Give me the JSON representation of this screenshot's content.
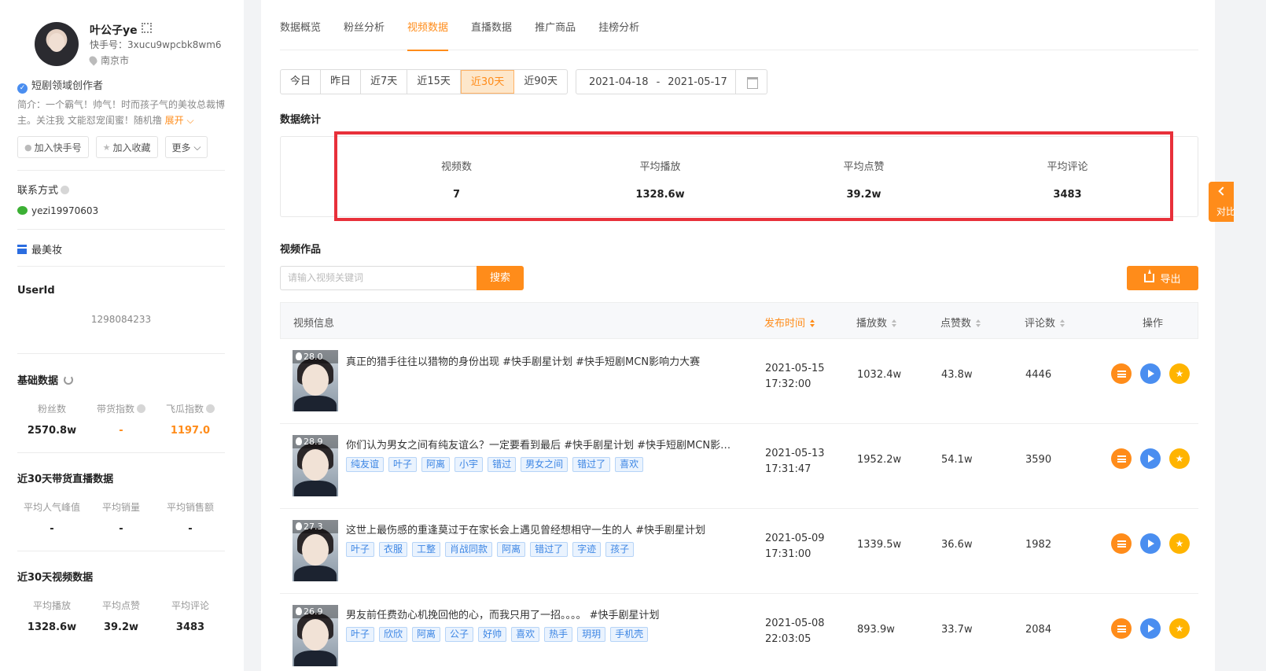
{
  "profile": {
    "name": "叶公子ye",
    "ks_id": "快手号：3xucu9wpcbk8wm6",
    "location": "南京市",
    "creator_label": "短剧领域创作者",
    "intro": "简介：一个霸气！帅气！时而孩子气的美妆总裁博主。关注我 文能怼宠闺蜜！随机撸",
    "expand": "展开",
    "btn_add_ks": "加入快手号",
    "btn_add_fav": "加入收藏",
    "btn_more": "更多"
  },
  "contact": {
    "title": "联系方式",
    "wechat": "yezi19970603"
  },
  "mcn": {
    "label": "最美妆"
  },
  "userid": {
    "title": "UserId",
    "value": "1298084233"
  },
  "basic": {
    "title": "基础数据",
    "items": [
      {
        "label": "粉丝数",
        "value": "2570.8w"
      },
      {
        "label": "带货指数",
        "value": "-"
      },
      {
        "label": "飞瓜指数",
        "value": "1197.0"
      }
    ]
  },
  "live30": {
    "title": "近30天带货直播数据",
    "items": [
      {
        "label": "平均人气峰值",
        "value": "-"
      },
      {
        "label": "平均销量",
        "value": "-"
      },
      {
        "label": "平均销售额",
        "value": "-"
      }
    ]
  },
  "video30": {
    "title": "近30天视频数据",
    "items": [
      {
        "label": "平均播放",
        "value": "1328.6w"
      },
      {
        "label": "平均点赞",
        "value": "39.2w"
      },
      {
        "label": "平均评论",
        "value": "3483"
      }
    ]
  },
  "tabs": [
    "数据概览",
    "粉丝分析",
    "视频数据",
    "直播数据",
    "推广商品",
    "挂榜分析"
  ],
  "ranges": [
    "今日",
    "昨日",
    "近7天",
    "近15天",
    "近30天",
    "近90天"
  ],
  "date_range": {
    "start": "2021-04-18",
    "sep": "-",
    "end": "2021-05-17"
  },
  "stats": {
    "title": "数据统计",
    "items": [
      {
        "label": "视频数",
        "value": "7"
      },
      {
        "label": "平均播放",
        "value": "1328.6w"
      },
      {
        "label": "平均点赞",
        "value": "39.2w"
      },
      {
        "label": "平均评论",
        "value": "3483"
      }
    ]
  },
  "works": {
    "title": "视频作品",
    "search_placeholder": "请输入视频关键词",
    "search_btn": "搜索",
    "export_btn": "导出",
    "columns": [
      "视频信息",
      "发布时间",
      "播放数",
      "点赞数",
      "评论数",
      "操作"
    ],
    "rows": [
      {
        "score": "28.0",
        "title": "真正的猎手往往以猎物的身份出现 #快手剧星计划 #快手短剧MCN影响力大赛",
        "tags": [],
        "date": "2021-05-15",
        "time": "17:32:00",
        "plays": "1032.4w",
        "likes": "43.8w",
        "comments": "4446"
      },
      {
        "score": "28.9",
        "title": "你们认为男女之间有纯友谊么？一定要看到最后 #快手剧星计划 #快手短剧MCN影…",
        "tags": [
          "纯友谊",
          "叶子",
          "阿离",
          "小宇",
          "错过",
          "男女之间",
          "错过了",
          "喜欢"
        ],
        "date": "2021-05-13",
        "time": "17:31:47",
        "plays": "1952.2w",
        "likes": "54.1w",
        "comments": "3590"
      },
      {
        "score": "27.3",
        "title": "这世上最伤感的重逢莫过于在家长会上遇见曾经想相守一生的人 #快手剧星计划",
        "tags": [
          "叶子",
          "衣服",
          "工整",
          "肖战同款",
          "阿离",
          "错过了",
          "字迹",
          "孩子"
        ],
        "date": "2021-05-09",
        "time": "17:31:00",
        "plays": "1339.5w",
        "likes": "36.6w",
        "comments": "1982"
      },
      {
        "score": "26.9",
        "title": "男友前任费劲心机挽回他的心，而我只用了一招。。。。 #快手剧星计划",
        "tags": [
          "叶子",
          "欣欣",
          "阿离",
          "公子",
          "好帅",
          "喜欢",
          "热手",
          "玥玥",
          "手机壳"
        ],
        "date": "2021-05-08",
        "time": "22:03:05",
        "plays": "893.9w",
        "likes": "33.7w",
        "comments": "2084"
      }
    ]
  },
  "compare": {
    "label": "对比"
  }
}
